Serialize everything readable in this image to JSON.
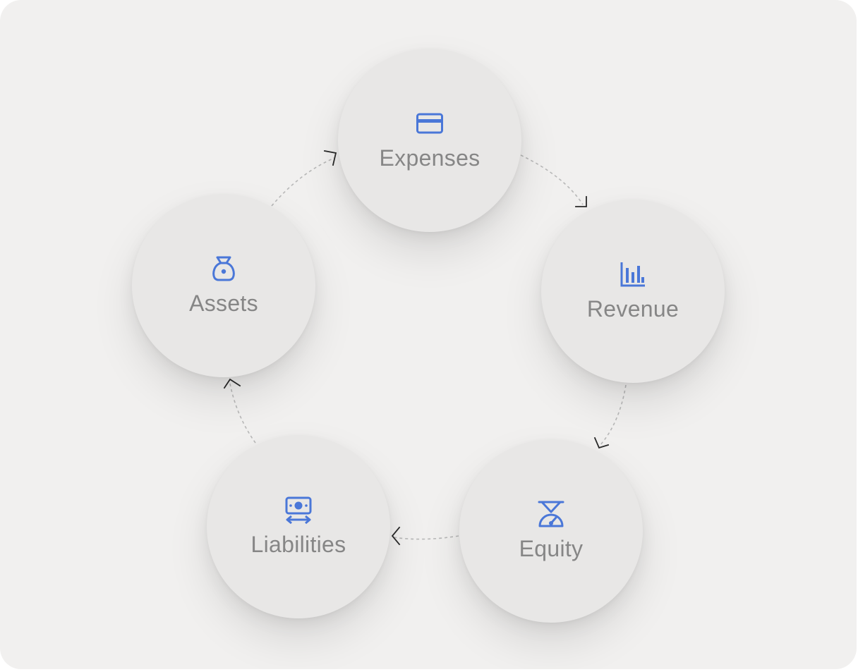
{
  "diagram": {
    "type": "cycle",
    "accent_color": "#4a77d8",
    "nodes": [
      {
        "key": "expenses",
        "label": "Expenses",
        "icon": "credit-card-icon"
      },
      {
        "key": "revenue",
        "label": "Revenue",
        "icon": "bar-chart-icon"
      },
      {
        "key": "equity",
        "label": "Equity",
        "icon": "scale-icon"
      },
      {
        "key": "liabilities",
        "label": "Liabilities",
        "icon": "money-transfer-icon"
      },
      {
        "key": "assets",
        "label": "Assets",
        "icon": "money-bag-icon"
      }
    ],
    "edges": [
      {
        "from": "expenses",
        "to": "revenue"
      },
      {
        "from": "revenue",
        "to": "equity"
      },
      {
        "from": "equity",
        "to": "liabilities"
      },
      {
        "from": "liabilities",
        "to": "assets"
      },
      {
        "from": "assets",
        "to": "expenses"
      }
    ]
  }
}
